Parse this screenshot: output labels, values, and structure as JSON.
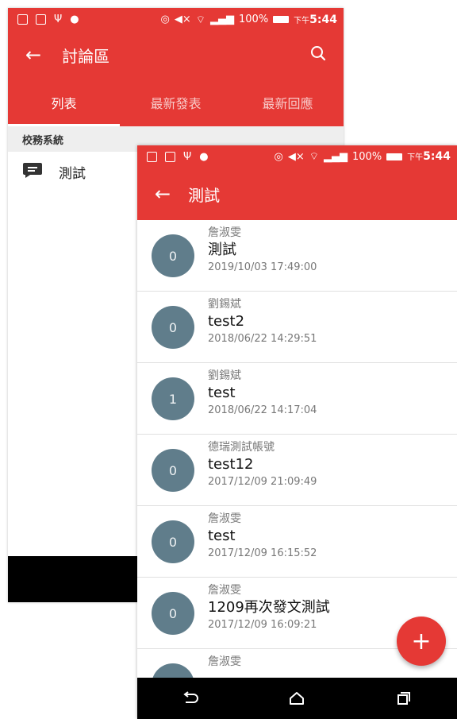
{
  "colors": {
    "primary": "#e53935",
    "avatar": "#607d8b",
    "fab": "#e53935"
  },
  "status_bar": {
    "back": {
      "battery": "100%",
      "ampm": "下午",
      "time": "5:44"
    },
    "front": {
      "battery": "100%",
      "ampm": "下午",
      "time": "5:44"
    }
  },
  "back_screen": {
    "title": "討論區",
    "icons": {
      "back": "arrow-left-icon",
      "search": "search-icon"
    },
    "tabs": [
      {
        "label": "列表",
        "active": true
      },
      {
        "label": "最新發表",
        "active": false
      },
      {
        "label": "最新回應",
        "active": false
      }
    ],
    "section": "校務系統",
    "forum_item": {
      "icon": "chat-icon",
      "label": "測試"
    }
  },
  "front_screen": {
    "title": "測試",
    "posts": [
      {
        "count": "0",
        "author": "詹淑雯",
        "title": "測試",
        "date": "2019/10/03 17:49:00"
      },
      {
        "count": "0",
        "author": "劉錫斌",
        "title": "test2",
        "date": "2018/06/22 14:29:51"
      },
      {
        "count": "1",
        "author": "劉錫斌",
        "title": "test",
        "date": "2018/06/22 14:17:04"
      },
      {
        "count": "0",
        "author": "德瑞測試帳號",
        "title": "test12",
        "date": "2017/12/09 21:09:49"
      },
      {
        "count": "0",
        "author": "詹淑雯",
        "title": "test",
        "date": "2017/12/09 16:15:52"
      },
      {
        "count": "0",
        "author": "詹淑雯",
        "title": "1209再次發文測試",
        "date": "2017/12/09 16:09:21"
      },
      {
        "count": "",
        "author": "詹淑雯",
        "title": "",
        "date": ""
      }
    ],
    "fab": {
      "icon": "plus-icon",
      "label": "+"
    }
  },
  "navigation": {
    "icons": [
      "back-icon",
      "home-icon",
      "recents-icon"
    ]
  }
}
